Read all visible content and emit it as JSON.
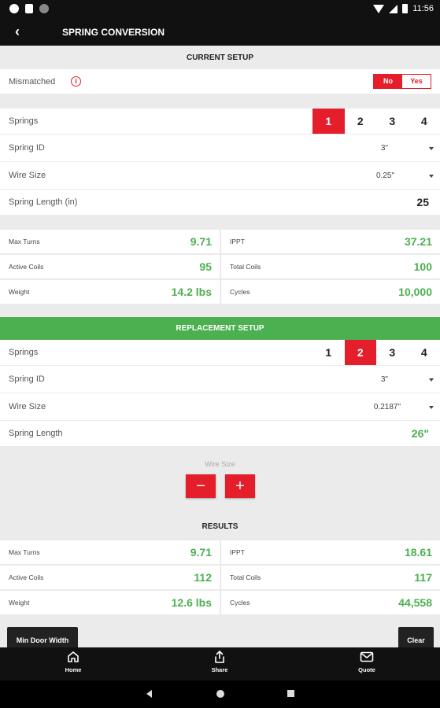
{
  "status_bar": {
    "time": "11:56"
  },
  "app_bar": {
    "back_label": "‹",
    "title": "SPRING CONVERSION"
  },
  "current": {
    "header": "CURRENT SETUP",
    "mismatched": {
      "label": "Mismatched",
      "info_glyph": "i",
      "no_label": "No",
      "yes_label": "Yes",
      "selected": "No"
    },
    "springs": {
      "label": "Springs",
      "options": [
        "1",
        "2",
        "3",
        "4"
      ],
      "selected": "1"
    },
    "spring_id": {
      "label": "Spring ID",
      "value": "3\""
    },
    "wire_size": {
      "label": "Wire Size",
      "value": "0.25\""
    },
    "spring_length": {
      "label": "Spring Length (in)",
      "value": "25"
    },
    "stats": {
      "max_turns": {
        "label": "Max Turns",
        "value": "9.71"
      },
      "ippt": {
        "label": "IPPT",
        "value": "37.21"
      },
      "active_coils": {
        "label": "Active Coils",
        "value": "95"
      },
      "total_coils": {
        "label": "Total Coils",
        "value": "100"
      },
      "weight": {
        "label": "Weight",
        "value": "14.2 lbs"
      },
      "cycles": {
        "label": "Cycles",
        "value": "10,000"
      }
    }
  },
  "replacement": {
    "header": "REPLACEMENT SETUP",
    "springs": {
      "label": "Springs",
      "options": [
        "1",
        "2",
        "3",
        "4"
      ],
      "selected": "2"
    },
    "spring_id": {
      "label": "Spring ID",
      "value": "3\""
    },
    "wire_size": {
      "label": "Wire Size",
      "value": "0.2187\""
    },
    "spring_length": {
      "label": "Spring Length",
      "value": "26\""
    },
    "wire_control": {
      "label": "Wire Size",
      "minus_label": "−",
      "plus_label": "+"
    }
  },
  "results": {
    "header": "RESULTS",
    "stats": {
      "max_turns": {
        "label": "Max Turns",
        "value": "9.71"
      },
      "ippt": {
        "label": "IPPT",
        "value": "18.61"
      },
      "active_coils": {
        "label": "Active Coils",
        "value": "112"
      },
      "total_coils": {
        "label": "Total Coils",
        "value": "117"
      },
      "weight": {
        "label": "Weight",
        "value": "12.6 lbs"
      },
      "cycles": {
        "label": "Cycles",
        "value": "44,558"
      }
    }
  },
  "buttons": {
    "min_door_width": "Min Door Width",
    "clear": "Clear"
  },
  "bottom_nav": {
    "home": "Home",
    "share": "Share",
    "quote": "Quote"
  },
  "colors": {
    "accent_red": "#e51e2b",
    "green": "#4cb050",
    "dark": "#111111"
  }
}
